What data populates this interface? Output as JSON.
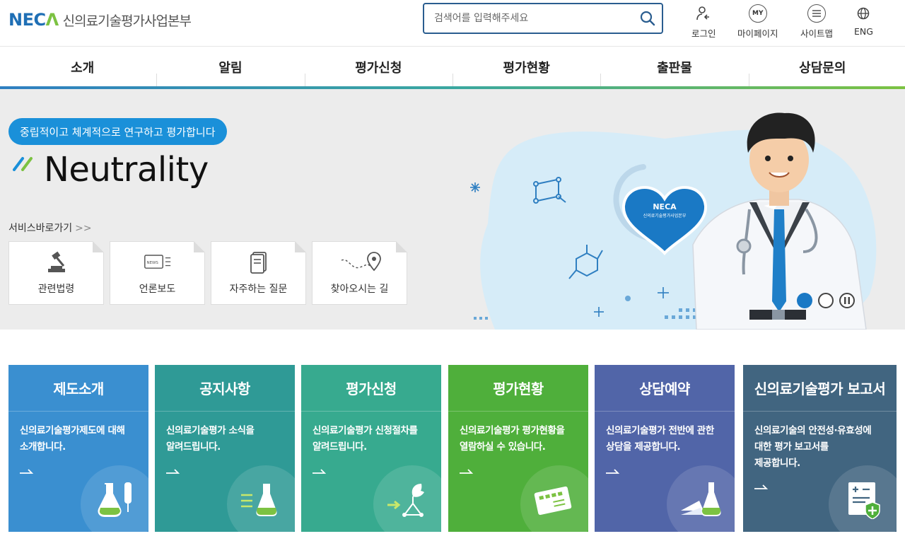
{
  "header": {
    "logo_mark": "NECA",
    "logo_text": "신의료기술평가사업본부",
    "search_placeholder": "검색어를 입력해주세요",
    "utils": [
      {
        "label": "로그인",
        "icon": "login-icon"
      },
      {
        "label": "마이페이지",
        "icon": "MY"
      },
      {
        "label": "사이트맵",
        "icon": "menu-icon"
      },
      {
        "label": "ENG",
        "icon": "globe-icon"
      }
    ]
  },
  "nav": [
    "소개",
    "알림",
    "평가신청",
    "평가현황",
    "출판물",
    "상담문의"
  ],
  "hero": {
    "pill": "중립적이고 체계적으로 연구하고 평가합니다",
    "title": "Neutrality",
    "badge_mark": "NECA",
    "badge_text": "신의료기술평가사업본부",
    "service_label": "서비스바로가기",
    "service_arrow": ">>",
    "services": [
      "관련법령",
      "언론보도",
      "자주하는 질문",
      "찾아오시는 길"
    ],
    "news_tag": "NEWS"
  },
  "cards": [
    {
      "title": "제도소개",
      "desc": [
        "신의료기술평가제도에 대해",
        "소개합니다."
      ],
      "color": "#3a8fd0"
    },
    {
      "title": "공지사항",
      "desc": [
        "신의료기술평가 소식을",
        "알려드립니다."
      ],
      "color": "#2f9a96"
    },
    {
      "title": "평가신청",
      "desc": [
        "신의료기술평가 신청절차를",
        "알려드립니다."
      ],
      "color": "#37aa8f"
    },
    {
      "title": "평가현황",
      "desc": [
        "신의료기술평가 평가현황을",
        "열람하실 수 있습니다."
      ],
      "color": "#4faf3b"
    },
    {
      "title": "상담예약",
      "desc": [
        "신의료기술평가 전반에 관한",
        "상담을 제공합니다."
      ],
      "color": "#5165a8"
    },
    {
      "title": "신의료기술평가 보고서",
      "desc": [
        "신의료기술의 안전성·유효성에",
        "대한 평가 보고서를",
        "제공합니다."
      ],
      "color": "#416580"
    }
  ],
  "colors": {
    "accent": "#1a90d9",
    "brand_blue": "#1f6fb5",
    "brand_green": "#7cc242"
  }
}
